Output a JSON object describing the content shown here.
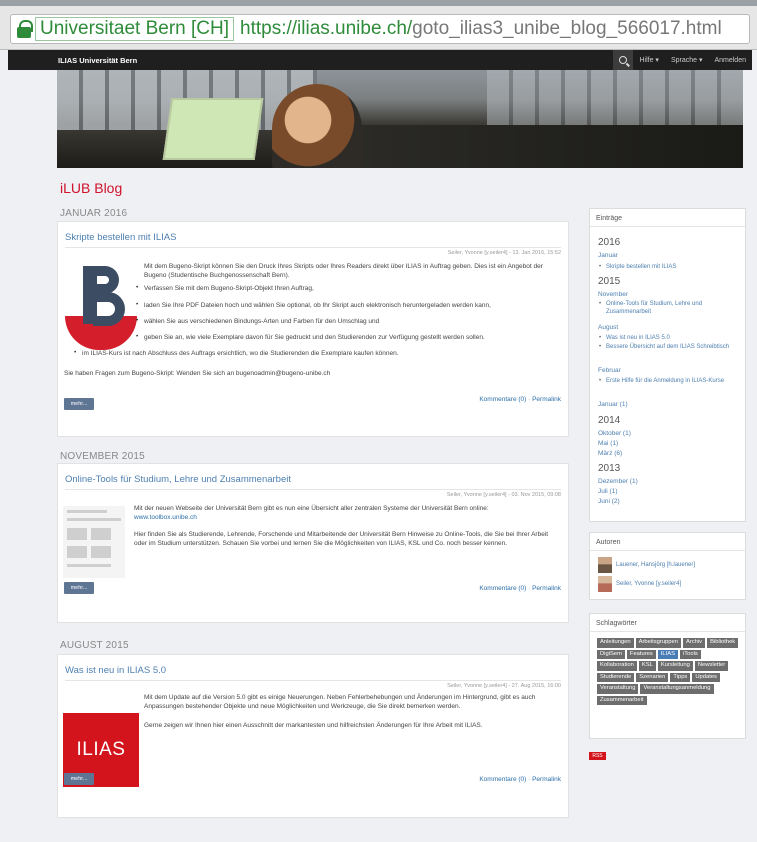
{
  "browser": {
    "site_identity": "Universitaet Bern [CH]",
    "url_host": "https://ilias.unibe.ch/",
    "url_path": "goto_ilias3_unibe_blog_566017.html"
  },
  "topbar": {
    "brand": "ILIAS Universität Bern",
    "menus": [
      "Hilfe ▾",
      "Sprache ▾",
      "Anmelden"
    ]
  },
  "page": {
    "title": "iLUB Blog"
  },
  "sections": [
    {
      "month": "JANUAR 2016",
      "title": "Skripte bestellen mit ILIAS",
      "meta": "Seiler, Yvonne [y.seiler4] - 13. Jan 2016, 15:52",
      "paragraphs": [
        "Mit dem Bugeno-Skript können Sie den Druck Ihres Skripts oder Ihres Readers direkt über ILIAS in Auftrag geben. Dies ist ein Angebot der Bugeno (Studentische Buchgenossenschaft Bern).",
        "Verfassen Sie mit dem Bugeno-Skript-Objekt Ihren Auftrag,",
        "laden Sie Ihre PDF Dateien hoch und wählen Sie optional, ob Ihr Skript auch elektronisch heruntergeladen werden kann,",
        "wählen Sie aus verschiedenen Bindungs-Arten und Farben für den Umschlag und",
        "geben Sie an, wie viele Exemplare davon für Sie gedruckt und den Studierenden zur Verfügung gestellt werden sollen.",
        "im ILIAS-Kurs ist nach Abschluss des Auftrags ersichtlich, wo die Studierenden die Exemplare kaufen können.",
        "Sie haben Fragen zum Bugeno-Skript: Wenden Sie sich an bugenoadmin@bugeno-unibe.ch"
      ],
      "more": "mehr...",
      "comments": "Kommentare (0)",
      "permalink": "Permalink"
    },
    {
      "month": "NOVEMBER 2015",
      "title": "Online-Tools für Studium, Lehre und Zusammenarbeit",
      "meta": "Seiler, Yvonne [y.seiler4] - 03. Nov 2015, 09:08",
      "paragraphs": [
        "Mit der neuen Webseite der Universität Bern gibt es nun eine Übersicht aller zentralen Systeme der Universität Bern online:",
        "www.toolbox.unibe.ch",
        "Hier finden Sie als Studierende, Lehrende, Forschende und Mitarbeitende der Universität Bern Hinweise zu Online-Tools, die Sie bei Ihrer Arbeit oder im Studium unterstützen. Schauen Sie vorbei und lernen Sie die Möglichkeiten von ILIAS, KSL und Co. noch besser kennen."
      ],
      "more": "mehr...",
      "comments": "Kommentare (0)",
      "permalink": "Permalink"
    },
    {
      "month": "AUGUST 2015",
      "title": "Was ist neu in ILIAS 5.0",
      "meta": "Seiler, Yvonne [y.seiler4] - 27. Aug 2015, 16:00",
      "logo": "ILIAS",
      "paragraphs": [
        "Mit dem Update auf die Version 5.0 gibt es einige Neuerungen. Neben Fehlerbehebungen und Änderungen im Hintergrund, gibt es auch Anpassungen bestehender Objekte und neue Möglichkeiten und Werkzeuge, die Sie direkt bemerken werden.",
        "Gerne zeigen wir Ihnen hier einen Ausschnitt der markantesten und hilfreichsten Änderungen für Ihre Arbeit mit ILIAS."
      ],
      "more": "mehr...",
      "comments": "Kommentare (0)",
      "permalink": "Permalink"
    }
  ],
  "sidebar": {
    "entries_title": "Einträge",
    "y2016": "2016",
    "jan2016": "Januar",
    "jan2016_item": "Skripte bestellen mit ILIAS",
    "y2015": "2015",
    "nov2015": "November",
    "nov2015_item": "Online-Tools für Studium, Lehre und Zusammenarbeit",
    "aug2015": "August",
    "aug2015_item1": "Was ist neu in ILIAS 5.0",
    "aug2015_item2": "Bessere Übersicht auf dem ILIAS Schreibtisch",
    "feb2015": "Februar",
    "feb2015_item": "Erste Hilfe für die Anmeldung in ILIAS-Kurse",
    "jan2015": "Januar (1)",
    "y2014": "2014",
    "oct2014": "Oktober (1)",
    "may2014": "Mai (1)",
    "mar2014": "März (6)",
    "y2013": "2013",
    "dec2013": "Dezember (1)",
    "jul2013": "Juli (1)",
    "jun2013": "Juni (2)",
    "authors_title": "Autoren",
    "author1": "Lauener, Hansjörg [h.lauener]",
    "author2": "Seiler, Yvonne [y.seiler4]",
    "tags_title": "Schlagwörter",
    "tags": [
      "Anleitungen",
      "Arbeitsgruppen",
      "Archiv",
      "Bibliothek",
      "DigiSem",
      "Features",
      "ILIAS",
      "iTools",
      "Kollaboration",
      "KSL",
      "Kursleitung",
      "Newsletter",
      "Studierende",
      "Szenarien",
      "Tipps",
      "Updates",
      "Veranstaltung",
      "Veranstaltungsanmeldung",
      "Zusammenarbeit"
    ],
    "rss": "RSS"
  }
}
